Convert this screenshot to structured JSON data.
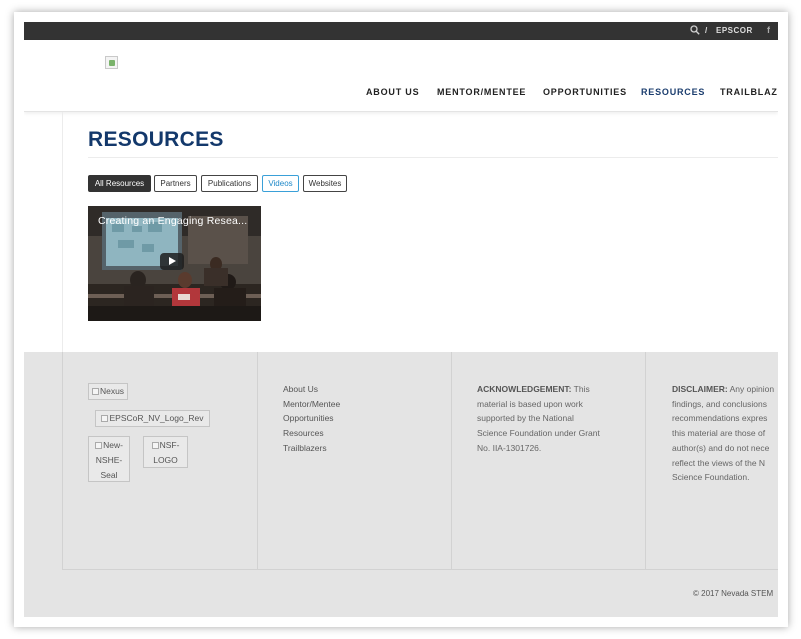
{
  "topbar": {
    "slash": "/",
    "epscor": "EPSCOR",
    "facebook": "f"
  },
  "header": {
    "logo_alt": "",
    "nav": [
      {
        "label": "ABOUT US"
      },
      {
        "label": "MENTOR/MENTEE"
      },
      {
        "label": "OPPORTUNITIES"
      },
      {
        "label": "RESOURCES"
      },
      {
        "label": "TRAILBLAZER"
      }
    ]
  },
  "main": {
    "title": "RESOURCES",
    "filters": [
      "All Resources",
      "Partners",
      "Publications",
      "Videos",
      "Websites"
    ],
    "video": {
      "title": "Creating an Engaging Resea..."
    }
  },
  "footer": {
    "images": {
      "nexus": "Nexus",
      "epscor_logo": "EPSCoR_NV_Logo_Rev",
      "nshe_seal": [
        "New-",
        "NSHE-",
        "Seal"
      ],
      "nsf_logo": [
        "NSF-",
        "LOGO"
      ]
    },
    "links": [
      "About Us",
      "Mentor/Mentee",
      "Opportunities",
      "Resources",
      "Trailblazers"
    ],
    "acknowledgement": {
      "label": "ACKNOWLEDGEMENT:",
      "lines": [
        " This",
        "material is based upon work",
        "supported by the National",
        "Science Foundation under Grant",
        "No. IIA-1301726."
      ]
    },
    "disclaimer": {
      "label": "DISCLAIMER:",
      "lines": [
        " Any opinion",
        "findings, and conclusions",
        "recommendations expres",
        "this material are those of",
        "author(s) and do not nece",
        "reflect the views of the N",
        "Science Foundation."
      ]
    },
    "copyright": "© 2017 Nevada STEM"
  },
  "colors": {
    "topbar_bg": "#333333",
    "title": "#13386b",
    "nav_active": "#1b3d6e",
    "footer_bg": "#e4e4e4",
    "filter_highlight": "#3aa0d8"
  },
  "icons": {
    "search": "search-icon",
    "facebook": "facebook-icon",
    "play": "play-icon"
  }
}
